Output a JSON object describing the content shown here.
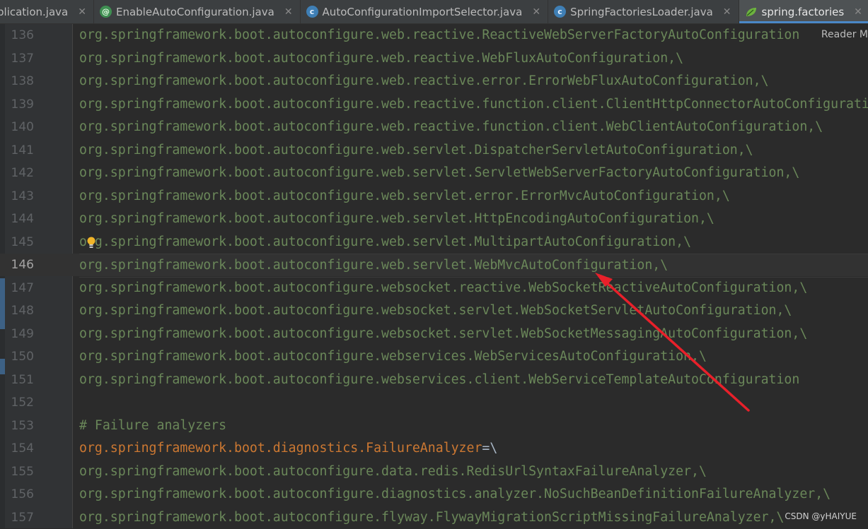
{
  "tabs": [
    {
      "label": "plication.java",
      "icon": "none",
      "active": false
    },
    {
      "label": "EnableAutoConfiguration.java",
      "icon": "annotation-icon",
      "active": false
    },
    {
      "label": "AutoConfigurationImportSelector.java",
      "icon": "class-icon",
      "active": false
    },
    {
      "label": "SpringFactoriesLoader.java",
      "icon": "class-icon",
      "active": false
    },
    {
      "label": "spring.factories",
      "icon": "spring-leaf-icon",
      "active": true
    }
  ],
  "reader_mode": "Reader M",
  "watermark": "CSDN @yHAIYUE",
  "colors": {
    "string": "#6a8759",
    "key": "#cc7832",
    "comment": "#808080",
    "accent": "#4a88c7",
    "arrow": "#e8202a"
  },
  "current_line": "146",
  "lines": [
    {
      "num": "136",
      "text": "org.springframework.boot.autoconfigure.web.reactive.ReactiveWebServerFactoryAutoConfiguration",
      "kind": "value"
    },
    {
      "num": "137",
      "text": "org.springframework.boot.autoconfigure.web.reactive.WebFluxAutoConfiguration,\\",
      "kind": "value"
    },
    {
      "num": "138",
      "text": "org.springframework.boot.autoconfigure.web.reactive.error.ErrorWebFluxAutoConfiguration,\\",
      "kind": "value"
    },
    {
      "num": "139",
      "text": "org.springframework.boot.autoconfigure.web.reactive.function.client.ClientHttpConnectorAutoConfigurati",
      "kind": "value"
    },
    {
      "num": "140",
      "text": "org.springframework.boot.autoconfigure.web.reactive.function.client.WebClientAutoConfiguration,\\",
      "kind": "value"
    },
    {
      "num": "141",
      "text": "org.springframework.boot.autoconfigure.web.servlet.DispatcherServletAutoConfiguration,\\",
      "kind": "value"
    },
    {
      "num": "142",
      "text": "org.springframework.boot.autoconfigure.web.servlet.ServletWebServerFactoryAutoConfiguration,\\",
      "kind": "value"
    },
    {
      "num": "143",
      "text": "org.springframework.boot.autoconfigure.web.servlet.error.ErrorMvcAutoConfiguration,\\",
      "kind": "value"
    },
    {
      "num": "144",
      "text": "org.springframework.boot.autoconfigure.web.servlet.HttpEncodingAutoConfiguration,\\",
      "kind": "value"
    },
    {
      "num": "145",
      "text": "org.springframework.boot.autoconfigure.web.servlet.MultipartAutoConfiguration,\\",
      "kind": "value"
    },
    {
      "num": "146",
      "text": "org.springframework.boot.autoconfigure.web.servlet.WebMvcAutoConfiguration,\\",
      "kind": "value"
    },
    {
      "num": "147",
      "text": "org.springframework.boot.autoconfigure.websocket.reactive.WebSocketReactiveAutoConfiguration,\\",
      "kind": "value"
    },
    {
      "num": "148",
      "text": "org.springframework.boot.autoconfigure.websocket.servlet.WebSocketServletAutoConfiguration,\\",
      "kind": "value"
    },
    {
      "num": "149",
      "text": "org.springframework.boot.autoconfigure.websocket.servlet.WebSocketMessagingAutoConfiguration,\\",
      "kind": "value"
    },
    {
      "num": "150",
      "text": "org.springframework.boot.autoconfigure.webservices.WebServicesAutoConfiguration,\\",
      "kind": "value"
    },
    {
      "num": "151",
      "text": "org.springframework.boot.autoconfigure.webservices.client.WebServiceTemplateAutoConfiguration",
      "kind": "value"
    },
    {
      "num": "152",
      "text": "",
      "kind": "blank"
    },
    {
      "num": "153",
      "text": "# Failure analyzers",
      "kind": "comment"
    },
    {
      "num": "154",
      "key": "org.springframework.boot.diagnostics.FailureAnalyzer",
      "sep": "=\\",
      "kind": "key"
    },
    {
      "num": "155",
      "text": "org.springframework.boot.autoconfigure.data.redis.RedisUrlSyntaxFailureAnalyzer,\\",
      "kind": "value"
    },
    {
      "num": "156",
      "text": "org.springframework.boot.autoconfigure.diagnostics.analyzer.NoSuchBeanDefinitionFailureAnalyzer,\\",
      "kind": "value"
    },
    {
      "num": "157",
      "text": "org.springframework.boot.autoconfigure.flyway.FlywayMigrationScriptMissingFailureAnalyzer,\\",
      "kind": "value"
    }
  ]
}
